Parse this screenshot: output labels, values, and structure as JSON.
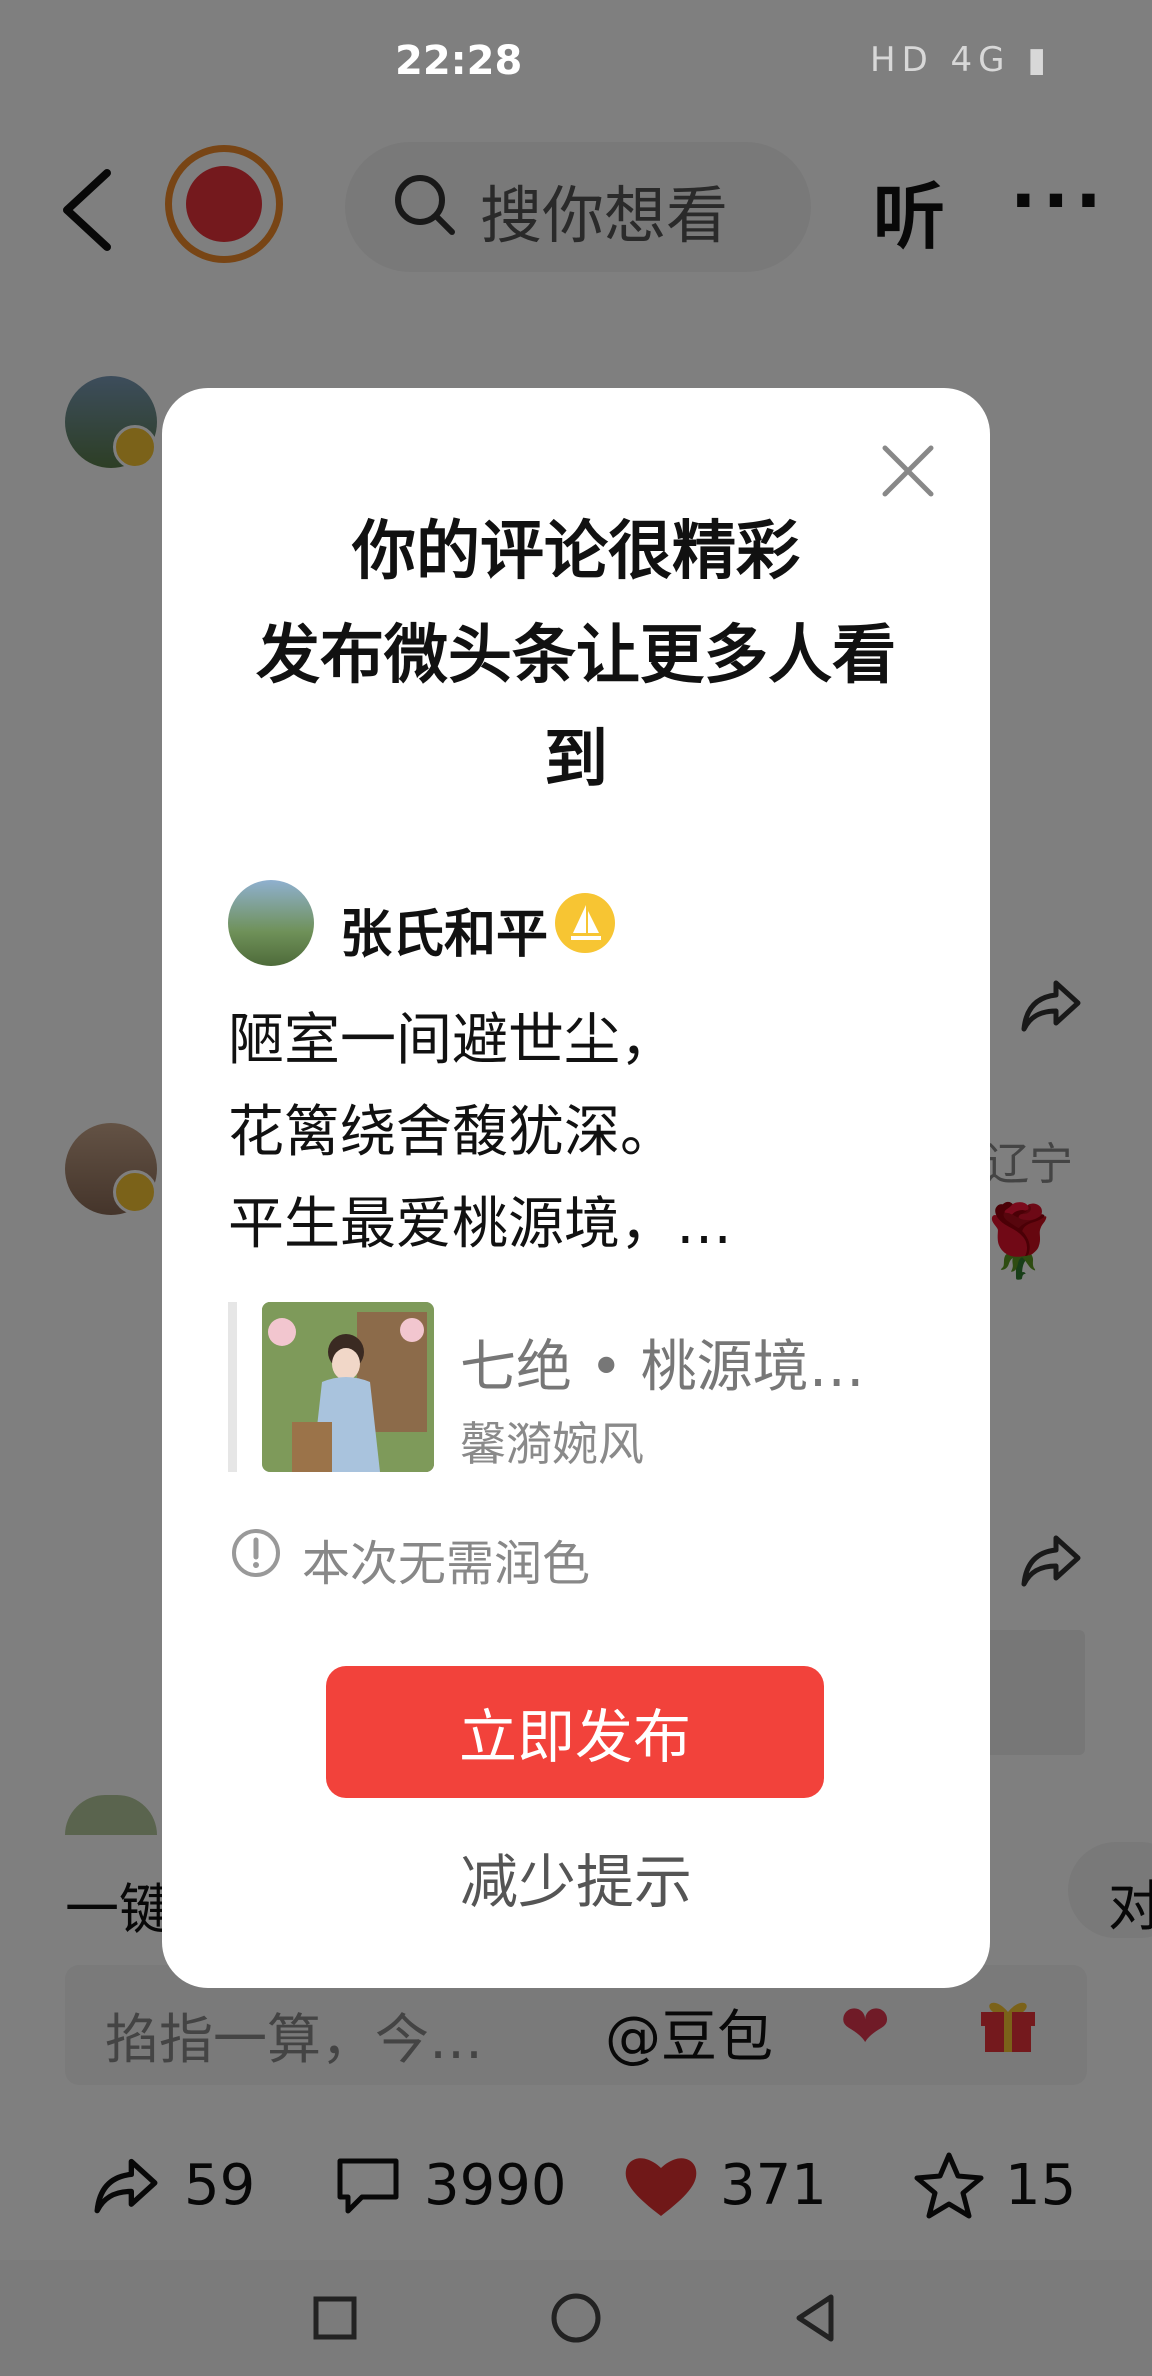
{
  "status_bar": {
    "time": "22:28",
    "icons": "HD 4G ▮"
  },
  "header": {
    "search_placeholder": "搜你想看",
    "listen_label": "听",
    "more_label": "···"
  },
  "background": {
    "location_partial": "辽宁",
    "rose": "🌹",
    "one_click_partial": "一键",
    "chip_partial": "对"
  },
  "comment_input": {
    "placeholder": "掐指一算，今…",
    "mention": "@豆包",
    "heart": "❤"
  },
  "actions": {
    "share_count": "59",
    "comment_count": "3990",
    "like_count": "371",
    "favorite_count": "15"
  },
  "dialog": {
    "title_lines": [
      "你的评论很精彩",
      "发布微头条让更多人看",
      "到"
    ],
    "author_name": "张氏和平",
    "poem_lines": [
      "陋室一间避世尘，",
      "花篱绕舍馥犹深。",
      "平生最爱桃源境，…"
    ],
    "quote_title": "七绝 • 桃源境…",
    "quote_author": "馨漪婉风",
    "tip": "本次无需润色",
    "publish_label": "立即发布",
    "reduce_label": "减少提示"
  },
  "colors": {
    "accent_red": "#f2423b",
    "badge_yellow": "#f7c533",
    "like_red": "#e03030"
  }
}
